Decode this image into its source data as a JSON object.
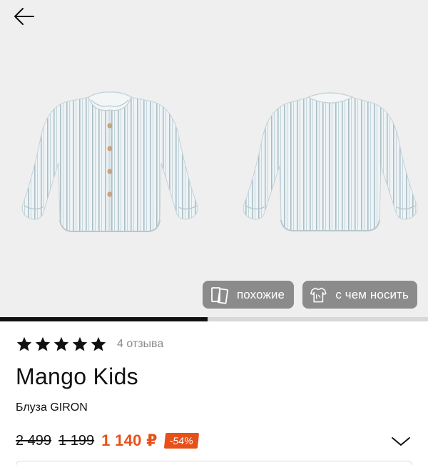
{
  "gallery": {
    "back_icon": "arrow-left-icon",
    "images": [
      "blouse-front",
      "blouse-back"
    ],
    "image_position": 0.485,
    "buttons": {
      "similar": {
        "label": "похожие",
        "icon": "similar-cards-icon"
      },
      "outfit": {
        "label": "с чем носить",
        "icon": "outfit-clothes-icon"
      }
    }
  },
  "product": {
    "rating_stars": 5,
    "reviews": "4 отзыва",
    "brand": "Mango Kids",
    "name": "Блуза GIRON",
    "price": {
      "original": "2 499",
      "previous": "1 199",
      "current": "1 140 ₽",
      "discount": "-54%"
    },
    "expand_icon": "chevron-down-icon"
  },
  "colors": {
    "accent": "#e8501a",
    "text": "#111111",
    "muted": "#8a8a8a",
    "gallery_bg": "#efefef"
  }
}
